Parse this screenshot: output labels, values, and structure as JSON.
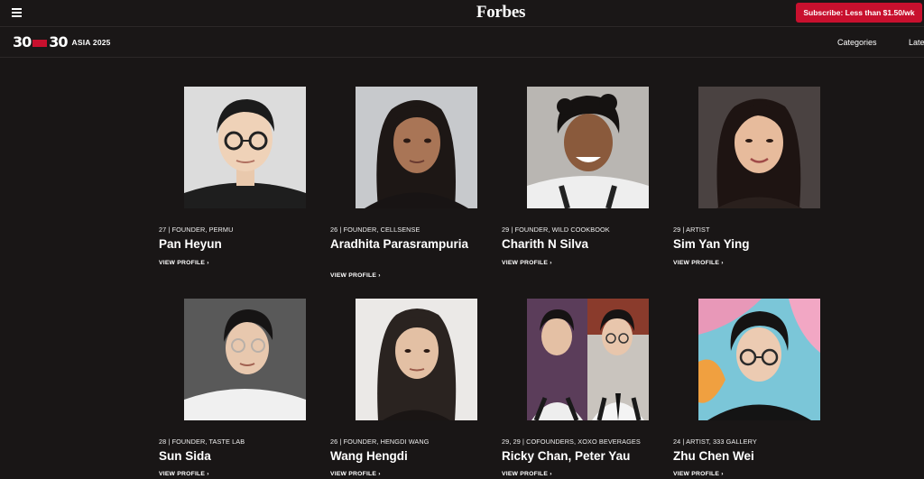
{
  "header": {
    "logo": "Forbes",
    "subscribe_label": "Subscribe: Less than $1.50/wk"
  },
  "nav": {
    "brand_left": "30",
    "brand_right": "30",
    "brand_tag": "ASIA 2025",
    "links": [
      "Categories",
      "Late"
    ]
  },
  "profiles": [
    {
      "meta": "27 | FOUNDER, PERMU",
      "name": "Pan Heyun",
      "link": "VIEW PROFILE"
    },
    {
      "meta": "26 | FOUNDER, CELLSENSE",
      "name": "Aradhita Parasrampuria",
      "link": "VIEW PROFILE"
    },
    {
      "meta": "29 | FOUNDER, WILD COOKBOOK",
      "name": "Charith N Silva",
      "link": "VIEW PROFILE"
    },
    {
      "meta": "29 | ARTIST",
      "name": "Sim Yan Ying",
      "link": "VIEW PROFILE"
    },
    {
      "meta": "28 | FOUNDER, TASTE LAB",
      "name": "Sun Sida",
      "link": "VIEW PROFILE"
    },
    {
      "meta": "26 | FOUNDER, HENGDI WANG",
      "name": "Wang Hengdi",
      "link": "VIEW PROFILE"
    },
    {
      "meta": "29, 29 | COFOUNDERS, XOXO BEVERAGES",
      "name": "Ricky Chan, Peter Yau",
      "link": "VIEW PROFILE"
    },
    {
      "meta": "24 | ARTIST, 333 GALLERY",
      "name": "Zhu Chen Wei",
      "link": "VIEW PROFILE"
    }
  ],
  "colors": {
    "background": "#191616",
    "accent": "#c8102e"
  }
}
